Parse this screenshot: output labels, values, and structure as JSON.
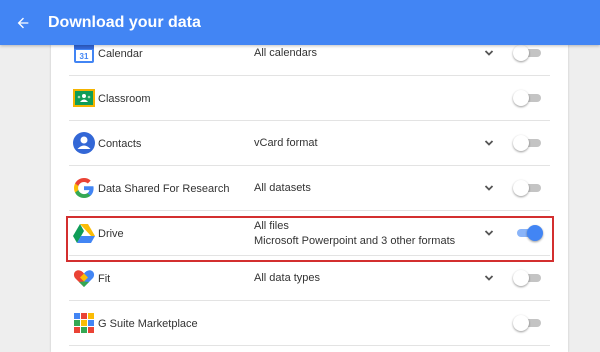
{
  "appbar": {
    "title": "Download your data",
    "back_icon": "arrow-back-icon",
    "color": "#4285f4"
  },
  "products": [
    {
      "name": "Calendar",
      "format": [
        "All calendars"
      ],
      "expandable": true,
      "enabled": false,
      "icon": "calendar-icon"
    },
    {
      "name": "Classroom",
      "format": [],
      "expandable": false,
      "enabled": false,
      "icon": "classroom-icon"
    },
    {
      "name": "Contacts",
      "format": [
        "vCard format"
      ],
      "expandable": true,
      "enabled": false,
      "icon": "contacts-icon"
    },
    {
      "name": "Data Shared For Research",
      "format": [
        "All datasets"
      ],
      "expandable": true,
      "enabled": false,
      "icon": "google-g-icon"
    },
    {
      "name": "Drive",
      "format": [
        "All files",
        "Microsoft Powerpoint and 3 other formats"
      ],
      "expandable": true,
      "enabled": true,
      "icon": "drive-icon",
      "highlighted": true
    },
    {
      "name": "Fit",
      "format": [
        "All data types"
      ],
      "expandable": true,
      "enabled": false,
      "icon": "fit-icon"
    },
    {
      "name": "G Suite Marketplace",
      "format": [],
      "expandable": false,
      "enabled": false,
      "icon": "marketplace-icon"
    }
  ],
  "colors": {
    "highlight": "#d32f2f",
    "toggle_on": "#4285f4",
    "toggle_off_track": "#c4c4c4"
  }
}
